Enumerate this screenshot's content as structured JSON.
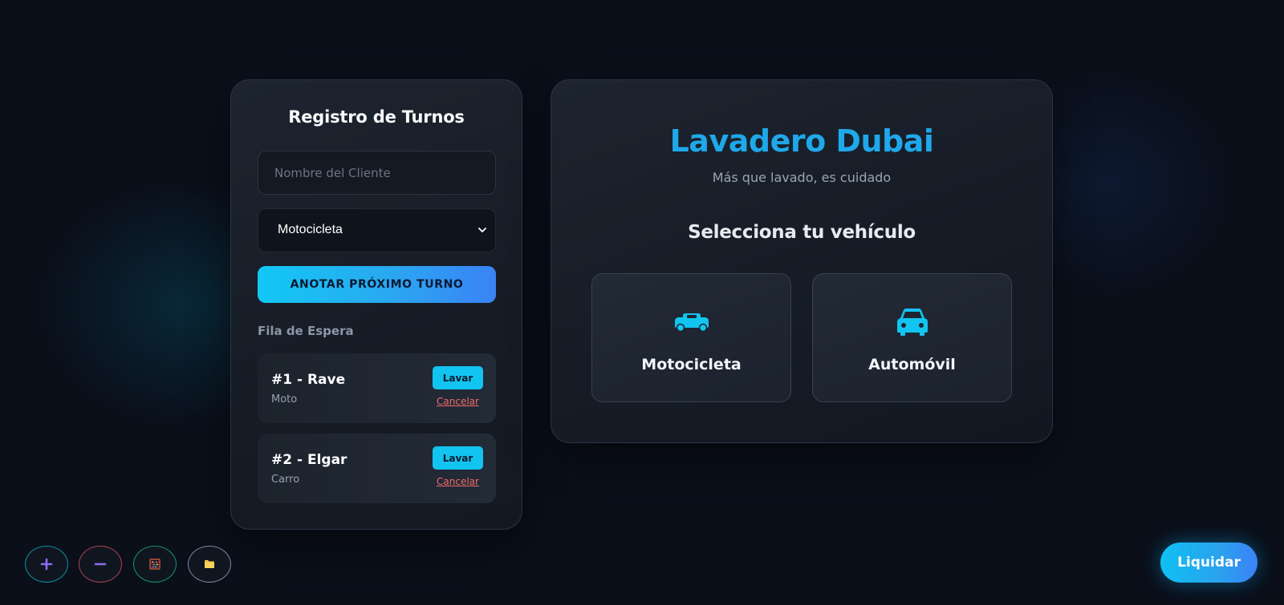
{
  "turns_panel": {
    "title": "Registro de Turnos",
    "client_input": {
      "placeholder": "Nombre del Cliente",
      "value": ""
    },
    "vehicle_select": {
      "selected": "Motocicleta"
    },
    "add_turn_label": "ANOTAR PRÓXIMO TURNO",
    "queue_title": "Fila de Espera",
    "queue": [
      {
        "label": "#1 - Rave",
        "vehicle": "Moto",
        "wash_label": "Lavar",
        "cancel_label": "Cancelar"
      },
      {
        "label": "#2 - Elgar",
        "vehicle": "Carro",
        "wash_label": "Lavar",
        "cancel_label": "Cancelar"
      }
    ]
  },
  "main_panel": {
    "brand": "Lavadero Dubai",
    "tagline": "Más que lavado, es cuidado",
    "select_title": "Selecciona tu vehículo",
    "vehicles": [
      {
        "label": "Motocicleta",
        "icon": "motorcycle-icon"
      },
      {
        "label": "Automóvil",
        "icon": "car-icon"
      }
    ]
  },
  "toolbar": {
    "buttons": [
      {
        "icon": "plus-icon"
      },
      {
        "icon": "minus-icon"
      },
      {
        "icon": "abacus-icon"
      },
      {
        "icon": "folder-icon"
      }
    ],
    "liquidar_label": "Liquidar"
  },
  "colors": {
    "accent": "#12c4f0",
    "brand_blue": "#1fa8ea",
    "danger": "#f06a6a",
    "background": "#0a0f1a"
  }
}
